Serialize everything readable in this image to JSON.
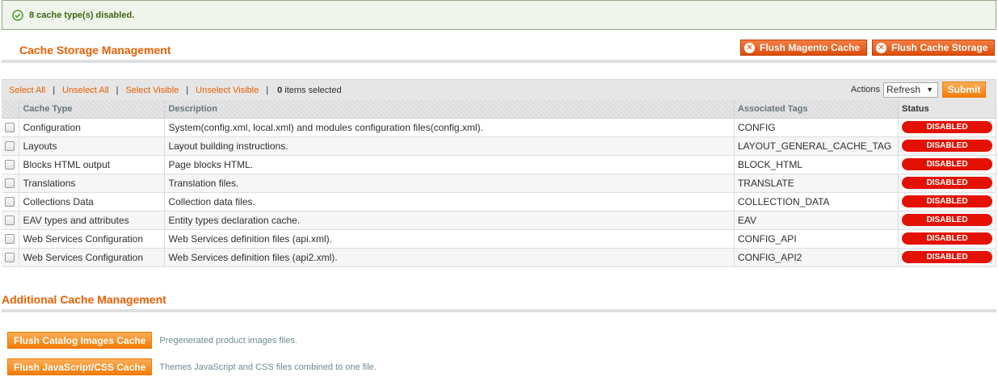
{
  "message": {
    "text": "8 cache type(s) disabled.",
    "icon": "check-circle-icon"
  },
  "cache_storage": {
    "title": "Cache Storage Management",
    "flush_magento_label": "Flush Magento Cache",
    "flush_storage_label": "Flush Cache Storage"
  },
  "massaction": {
    "select_all": "Select All",
    "unselect_all": "Unselect All",
    "select_visible": "Select Visible",
    "unselect_visible": "Unselect Visible",
    "selected_count": "0",
    "selected_suffix": "items selected",
    "actions_label": "Actions",
    "action_value": "Refresh",
    "submit_label": "Submit"
  },
  "grid": {
    "columns": [
      "Cache Type",
      "Description",
      "Associated Tags",
      "Status"
    ],
    "rows": [
      {
        "type": "Configuration",
        "description": "System(config.xml, local.xml) and modules configuration files(config.xml).",
        "tags": "CONFIG",
        "status": "DISABLED"
      },
      {
        "type": "Layouts",
        "description": "Layout building instructions.",
        "tags": "LAYOUT_GENERAL_CACHE_TAG",
        "status": "DISABLED"
      },
      {
        "type": "Blocks HTML output",
        "description": "Page blocks HTML.",
        "tags": "BLOCK_HTML",
        "status": "DISABLED"
      },
      {
        "type": "Translations",
        "description": "Translation files.",
        "tags": "TRANSLATE",
        "status": "DISABLED"
      },
      {
        "type": "Collections Data",
        "description": "Collection data files.",
        "tags": "COLLECTION_DATA",
        "status": "DISABLED"
      },
      {
        "type": "EAV types and attributes",
        "description": "Entity types declaration cache.",
        "tags": "EAV",
        "status": "DISABLED"
      },
      {
        "type": "Web Services Configuration",
        "description": "Web Services definition files (api.xml).",
        "tags": "CONFIG_API",
        "status": "DISABLED"
      },
      {
        "type": "Web Services Configuration",
        "description": "Web Services definition files (api2.xml).",
        "tags": "CONFIG_API2",
        "status": "DISABLED"
      }
    ]
  },
  "additional": {
    "title": "Additional Cache Management",
    "flush_images_label": "Flush Catalog Images Cache",
    "flush_images_note": "Pregenerated product images files.",
    "flush_js_label": "Flush JavaScript/CSS Cache",
    "flush_js_note": "Themes JavaScript and CSS files combined to one file."
  },
  "colors": {
    "accent": "#eb5e00",
    "disabled": "#e41101",
    "success_text": "#3d6611"
  }
}
